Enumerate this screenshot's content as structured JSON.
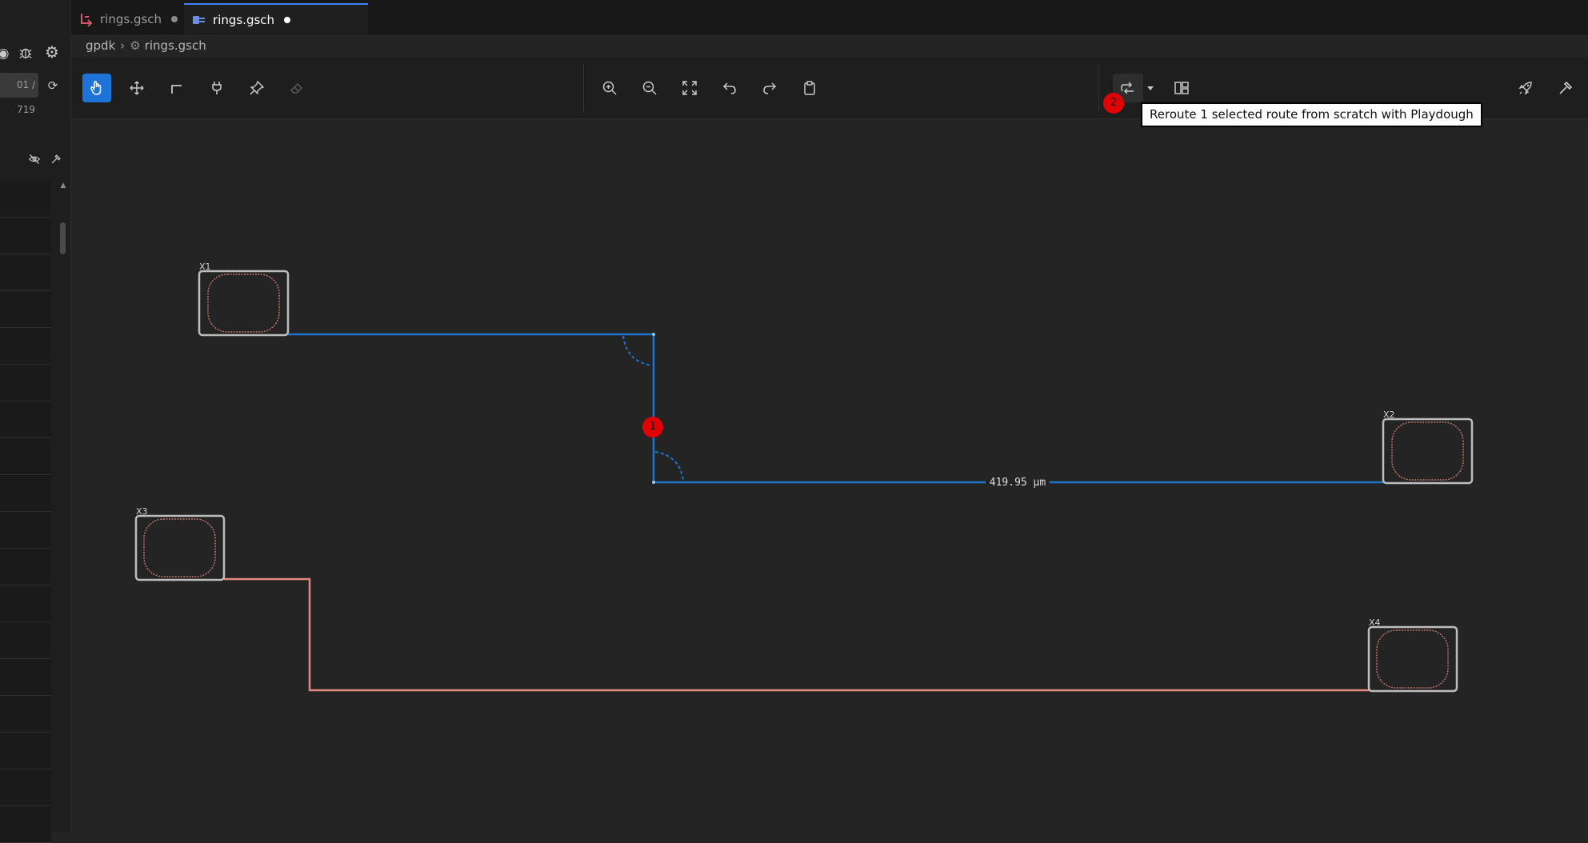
{
  "left_panel": {
    "page_counter": "01 / 719"
  },
  "tabs": [
    {
      "label": "rings.gsch",
      "active": false,
      "modified": true,
      "icon": "route-icon"
    },
    {
      "label": "rings.gsch",
      "active": true,
      "modified": true,
      "icon": "schematic-icon"
    }
  ],
  "breadcrumb": {
    "root": "gpdk",
    "file": "rings.gsch"
  },
  "toolbar": {
    "left_tools": [
      "select-hand-icon",
      "move-icon",
      "route-icon",
      "plug-icon",
      "pin-icon",
      "eraser-icon"
    ],
    "center_tools": [
      "zoom-in-icon",
      "zoom-out-icon",
      "fit-view-icon",
      "undo-icon",
      "redo-icon",
      "clipboard-icon"
    ],
    "right_tools": [
      "reroute-icon",
      "dropdown-icon",
      "layout-icon"
    ],
    "far_right_tools": [
      "rocket-icon",
      "hammer-icon"
    ]
  },
  "tooltip": "Reroute 1 selected route from scratch with Playdough",
  "badges": {
    "canvas_marker": "1",
    "toolbar_marker": "2"
  },
  "schematic": {
    "instances": [
      {
        "label": "X1"
      },
      {
        "label": "X2"
      },
      {
        "label": "X3"
      },
      {
        "label": "X4"
      }
    ],
    "selected_route_length": "419.95 µm",
    "colors": {
      "selected_route": "#1e73c8",
      "unselected_route": "#e38a80",
      "instance_border": "#bdbdbd",
      "ring": "#c0706a",
      "badge": "#e00000",
      "accent": "#1e73d8"
    }
  }
}
